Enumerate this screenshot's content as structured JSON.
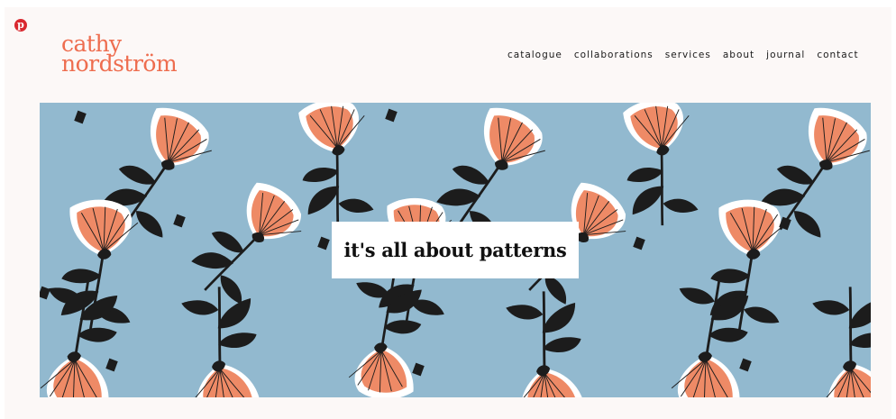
{
  "social": {
    "pinterest_glyph": "p",
    "icon": "pinterest-icon"
  },
  "brand": {
    "line1": "cathy",
    "line2": "nordström",
    "color": "#ee6d4f"
  },
  "nav": {
    "items": [
      {
        "label": "catalogue"
      },
      {
        "label": "collaborations"
      },
      {
        "label": "services"
      },
      {
        "label": "about"
      },
      {
        "label": "journal"
      },
      {
        "label": "contact"
      }
    ]
  },
  "hero": {
    "tagline": "it's all about patterns",
    "pattern_colors": {
      "background": "#92b9cf",
      "petal": "#ee8a66",
      "petal_outline": "#ffffff",
      "leaf": "#1c1c1c"
    }
  }
}
